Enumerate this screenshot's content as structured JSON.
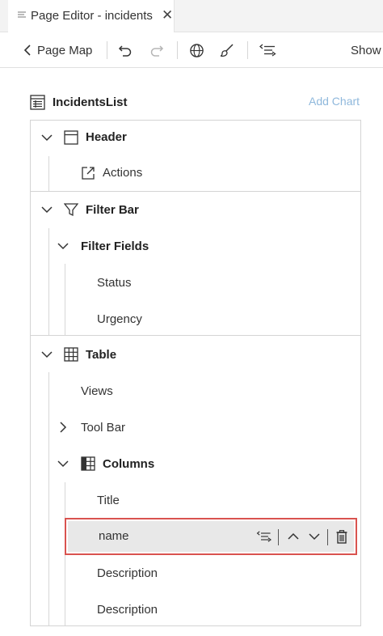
{
  "tab": {
    "title": "Page Editor - incidents",
    "close_glyph": "✕"
  },
  "toolbar": {
    "page_map_label": "Page Map",
    "show_label": "Show",
    "icons": [
      "chevron-left-icon",
      "undo-icon",
      "redo-icon",
      "globe-icon",
      "brush-icon",
      "outline-icon"
    ]
  },
  "outline": {
    "title": "IncidentsList",
    "add_chart_label": "Add Chart",
    "header": {
      "label": "Header",
      "actions_label": "Actions"
    },
    "filter_bar": {
      "label": "Filter Bar",
      "filter_fields_label": "Filter Fields",
      "fields": [
        "Status",
        "Urgency"
      ]
    },
    "table": {
      "label": "Table",
      "views_label": "Views",
      "tool_bar_label": "Tool Bar",
      "columns_label": "Columns",
      "columns": [
        "Title",
        "name",
        "Description",
        "Description"
      ]
    }
  },
  "colors": {
    "selection_border": "#d9534f",
    "selection_fill": "#e8e8e8",
    "link_disabled": "#8fb8dc"
  }
}
